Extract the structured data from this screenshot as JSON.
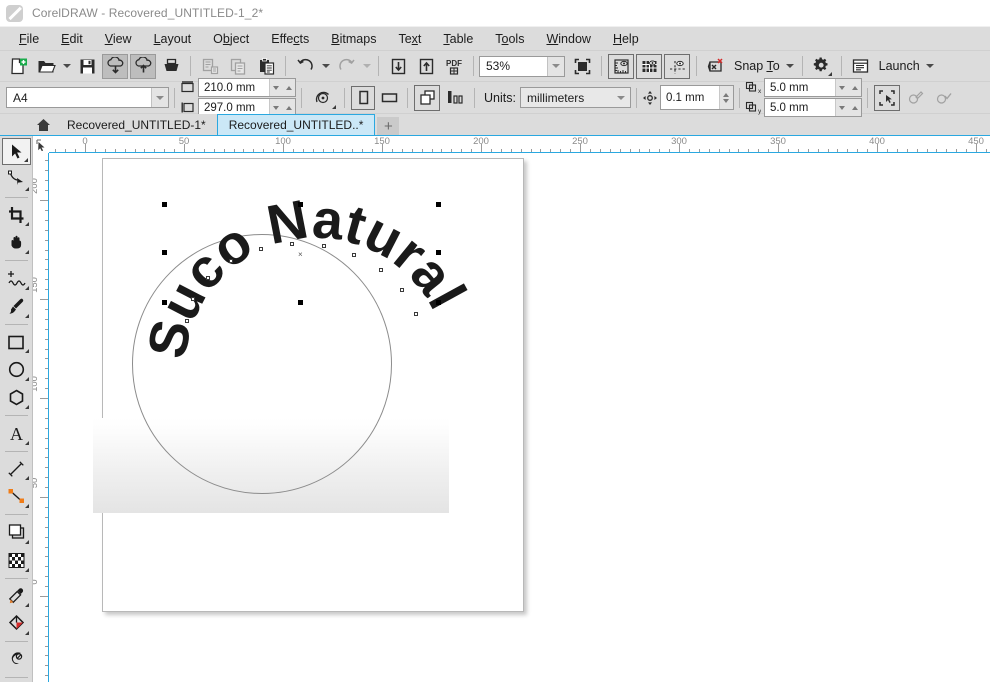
{
  "titlebar": {
    "app_name": "CorelDRAW",
    "title": "CorelDRAW - Recovered_UNTITLED-1_2*",
    "logo_icon": "coreldraw-balloon-icon"
  },
  "menubar": {
    "items": [
      {
        "label": "File",
        "mnemonic": "F"
      },
      {
        "label": "Edit",
        "mnemonic": "E"
      },
      {
        "label": "View",
        "mnemonic": "V"
      },
      {
        "label": "Layout",
        "mnemonic": "L"
      },
      {
        "label": "Object",
        "mnemonic": "O"
      },
      {
        "label": "Effects",
        "mnemonic": "c"
      },
      {
        "label": "Bitmaps",
        "mnemonic": "B"
      },
      {
        "label": "Text",
        "mnemonic": "x"
      },
      {
        "label": "Table",
        "mnemonic": "T"
      },
      {
        "label": "Tools",
        "mnemonic": "o"
      },
      {
        "label": "Window",
        "mnemonic": "W"
      },
      {
        "label": "Help",
        "mnemonic": "H"
      }
    ]
  },
  "standard_toolbar": {
    "buttons": [
      {
        "name": "new-document-button",
        "icon": "new-page-icon",
        "state": "normal"
      },
      {
        "name": "open-document-button",
        "icon": "open-folder-icon",
        "state": "normal"
      },
      {
        "name": "open-dropdown",
        "icon": "chevron-down-icon",
        "state": "normal"
      },
      {
        "name": "save-button",
        "icon": "floppy-disk-icon",
        "state": "normal"
      },
      {
        "name": "import-button",
        "icon": "cloud-download-icon",
        "state": "pressed"
      },
      {
        "name": "export-button",
        "icon": "cloud-upload-icon",
        "state": "pressed"
      },
      {
        "name": "print-button",
        "icon": "printer-icon",
        "state": "normal"
      },
      {
        "name": "cut-button",
        "icon": "cut-icon",
        "state": "disabled"
      },
      {
        "name": "copy-button",
        "icon": "copy-icon",
        "state": "disabled"
      },
      {
        "name": "paste-button",
        "icon": "paste-icon",
        "state": "normal"
      },
      {
        "name": "undo-button",
        "icon": "undo-arrow-icon",
        "state": "normal"
      },
      {
        "name": "undo-dropdown",
        "icon": "chevron-down-icon",
        "state": "normal"
      },
      {
        "name": "redo-button",
        "icon": "redo-arrow-icon",
        "state": "disabled"
      },
      {
        "name": "redo-dropdown",
        "icon": "chevron-down-icon",
        "state": "disabled"
      },
      {
        "name": "import-file-button",
        "icon": "import-arrow-down-icon",
        "state": "normal"
      },
      {
        "name": "export-file-button",
        "icon": "export-arrow-up-icon",
        "state": "normal"
      },
      {
        "name": "publish-pdf-button",
        "icon": "pdf-icon",
        "state": "normal"
      },
      {
        "name": "full-screen-preview-button",
        "icon": "fullscreen-preview-icon",
        "state": "normal"
      },
      {
        "name": "show-rulers-button",
        "icon": "ruler-eye-icon",
        "state": "boxed"
      },
      {
        "name": "show-grid-button",
        "icon": "grid-eye-icon",
        "state": "boxed"
      },
      {
        "name": "show-guidelines-button",
        "icon": "guideline-eye-icon",
        "state": "boxed"
      },
      {
        "name": "view-no-clip-button",
        "icon": "clip-off-icon",
        "state": "normal"
      },
      {
        "name": "options-button",
        "icon": "gear-icon",
        "state": "normal"
      },
      {
        "name": "launch-button",
        "icon": "launch-window-icon",
        "state": "normal"
      }
    ],
    "zoom_level": "53%",
    "snap_to_label": "Snap To",
    "snap_to_mnemonic": "T",
    "launch_label": "Launch"
  },
  "property_bar": {
    "page_preset": "A4",
    "page_width": "210.0 mm",
    "page_height": "297.0 mm",
    "units_label": "Units:",
    "units_value": "millimeters",
    "nudge_offset": "0.1 mm",
    "duplicate_x": "5.0 mm",
    "duplicate_y": "5.0 mm",
    "buttons": [
      {
        "name": "page-orientation-portrait-button",
        "icon": "portrait-page-icon",
        "state": "boxed"
      },
      {
        "name": "page-orientation-landscape-button",
        "icon": "landscape-page-icon",
        "state": "normal"
      },
      {
        "name": "all-pages-button",
        "icon": "all-pages-icon",
        "state": "boxed"
      },
      {
        "name": "current-page-button",
        "icon": "current-page-icon",
        "state": "normal"
      },
      {
        "name": "drawing-scale-button",
        "icon": "drawing-scale-icon",
        "state": "normal"
      },
      {
        "name": "snap-options-button",
        "icon": "snap-frame-icon",
        "state": "boxed"
      },
      {
        "name": "edit-document-button",
        "icon": "edit-pencil-icon",
        "state": "disabled"
      },
      {
        "name": "accept-document-button",
        "icon": "check-mark-icon",
        "state": "disabled"
      }
    ]
  },
  "tabbar": {
    "home_icon": "home-icon",
    "tabs": [
      {
        "label": "Recovered_UNTITLED-1*",
        "active": false
      },
      {
        "label": "Recovered_UNTITLED..*",
        "active": true
      }
    ],
    "new_tab_label": "+"
  },
  "toolbox": {
    "tools": [
      {
        "name": "pick-tool",
        "icon": "arrow-cursor-icon",
        "active": true,
        "flyout": true
      },
      {
        "name": "shape-tool",
        "icon": "shape-node-icon",
        "active": false,
        "flyout": true
      },
      {
        "name": "crop-tool",
        "icon": "crop-icon",
        "active": false,
        "flyout": true
      },
      {
        "name": "pan-tool",
        "icon": "hand-icon",
        "active": false,
        "flyout": true
      },
      {
        "name": "freehand-tool",
        "icon": "freehand-curve-icon",
        "active": false,
        "flyout": true
      },
      {
        "name": "artistic-media-tool",
        "icon": "paint-brush-icon",
        "active": false,
        "flyout": true
      },
      {
        "name": "rectangle-tool",
        "icon": "rectangle-icon",
        "active": false,
        "flyout": true
      },
      {
        "name": "ellipse-tool",
        "icon": "ellipse-icon",
        "active": false,
        "flyout": true
      },
      {
        "name": "polygon-tool",
        "icon": "polygon-icon",
        "active": false,
        "flyout": true
      },
      {
        "name": "text-tool",
        "icon": "text-a-icon",
        "active": false,
        "flyout": true
      },
      {
        "name": "dimension-tool",
        "icon": "dimension-line-icon",
        "active": false,
        "flyout": true
      },
      {
        "name": "connector-tool",
        "icon": "connector-line-icon",
        "active": false,
        "flyout": true
      },
      {
        "name": "drop-shadow-tool",
        "icon": "drop-shadow-icon",
        "active": false,
        "flyout": true
      },
      {
        "name": "transparency-tool",
        "icon": "checkerboard-icon",
        "active": false,
        "flyout": true
      },
      {
        "name": "color-eyedropper-tool",
        "icon": "eyedropper-icon",
        "active": false,
        "flyout": true
      },
      {
        "name": "interactive-fill-tool",
        "icon": "fill-bucket-icon",
        "active": false,
        "flyout": true
      },
      {
        "name": "smart-fill-tool",
        "icon": "smart-fill-icon",
        "active": false,
        "flyout": false
      }
    ]
  },
  "rulers": {
    "unit": "millimeters",
    "horizontal_labels": [
      "0",
      "50",
      "100",
      "150",
      "200",
      "250",
      "300",
      "350",
      "400",
      "450"
    ],
    "vertical_labels": [
      "200",
      "150",
      "100",
      "50",
      "0"
    ]
  },
  "canvas": {
    "page_size": "A4",
    "artwork": {
      "text_on_path": "Suco Natural",
      "path_shape": "circle",
      "text_color": "#1a1a1a",
      "path_stroke_color": "#8c8c8c",
      "gradient_rect_from": "#ffffff",
      "gradient_rect_to": "#e4e4e4",
      "selected": true
    }
  }
}
